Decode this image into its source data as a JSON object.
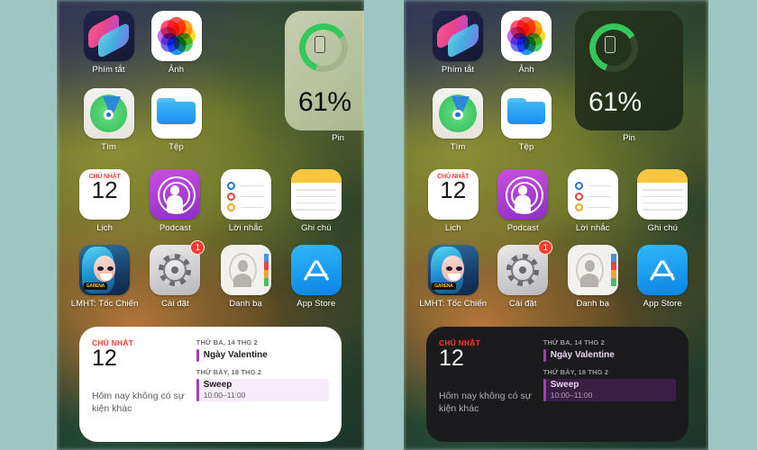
{
  "page": {
    "background_color": "#9dc6c2",
    "description": "Two iPhone home screen screenshots side by side showing light and dark appearance"
  },
  "phones": [
    {
      "id": "light",
      "mode": "light",
      "battery_widget": {
        "percent_label": "61%",
        "percent_value": 61,
        "label": "Pin",
        "ring_color": "#34c759",
        "glyph": "phone-icon"
      },
      "calendar_widget": {
        "weekday": "CHỦ NHẬT",
        "day": "12",
        "no_events": "Hôm nay không có sự kiện khác",
        "sections": [
          {
            "header": "THỨ BA, 14 THG 2",
            "events": [
              {
                "title": "Ngày Valentine",
                "time": "",
                "filled": false,
                "accent": "#a23fb8"
              }
            ]
          },
          {
            "header": "THỨ BẢY, 18 THG 2",
            "events": [
              {
                "title": "Sweep",
                "time": "10:00–11:00",
                "filled": true,
                "accent": "#a23fb8"
              }
            ]
          }
        ]
      },
      "app_rows": [
        [
          {
            "label": "Phím tắt",
            "icon": "shortcuts-icon",
            "badge": null
          },
          {
            "label": "Ảnh",
            "icon": "photos-icon",
            "badge": null
          }
        ],
        [
          {
            "label": "Tìm",
            "icon": "findmy-icon",
            "badge": null
          },
          {
            "label": "Tệp",
            "icon": "files-icon",
            "badge": null
          }
        ],
        [
          {
            "label": "Lịch",
            "icon": "calendar-icon",
            "badge": null,
            "cal_top": "CHỦ NHẬT",
            "cal_day": "12"
          },
          {
            "label": "Podcast",
            "icon": "podcasts-icon",
            "badge": null
          },
          {
            "label": "Lời nhắc",
            "icon": "reminders-icon",
            "badge": null
          },
          {
            "label": "Ghi chú",
            "icon": "notes-icon",
            "badge": null
          }
        ],
        [
          {
            "label": "LMHT: Tốc Chiến",
            "icon": "game-icon",
            "badge": null,
            "tag": "GARENA"
          },
          {
            "label": "Cài đặt",
            "icon": "settings-icon",
            "badge": "1"
          },
          {
            "label": "Danh bạ",
            "icon": "contacts-icon",
            "badge": null
          },
          {
            "label": "App Store",
            "icon": "appstore-icon",
            "badge": null
          }
        ]
      ]
    },
    {
      "id": "dark",
      "mode": "dark",
      "battery_widget": {
        "percent_label": "61%",
        "percent_value": 61,
        "label": "Pin",
        "ring_color": "#34c759",
        "glyph": "phone-icon"
      },
      "calendar_widget": {
        "weekday": "CHỦ NHẬT",
        "day": "12",
        "no_events": "Hôm nay không có sự kiện khác",
        "sections": [
          {
            "header": "THỨ BA, 14 THG 2",
            "events": [
              {
                "title": "Ngày Valentine",
                "time": "",
                "filled": false,
                "accent": "#a23fb8"
              }
            ]
          },
          {
            "header": "THỨ BẢY, 18 THG 2",
            "events": [
              {
                "title": "Sweep",
                "time": "10:00–11:00",
                "filled": true,
                "accent": "#a23fb8"
              }
            ]
          }
        ]
      },
      "app_rows": [
        [
          {
            "label": "Phím tắt",
            "icon": "shortcuts-icon",
            "badge": null
          },
          {
            "label": "Ảnh",
            "icon": "photos-icon",
            "badge": null
          }
        ],
        [
          {
            "label": "Tìm",
            "icon": "findmy-icon",
            "badge": null
          },
          {
            "label": "Tệp",
            "icon": "files-icon",
            "badge": null
          }
        ],
        [
          {
            "label": "Lịch",
            "icon": "calendar-icon",
            "badge": null,
            "cal_top": "CHỦ NHẬT",
            "cal_day": "12"
          },
          {
            "label": "Podcast",
            "icon": "podcasts-icon",
            "badge": null
          },
          {
            "label": "Lời nhắc",
            "icon": "reminders-icon",
            "badge": null
          },
          {
            "label": "Ghi chú",
            "icon": "notes-icon",
            "badge": null
          }
        ],
        [
          {
            "label": "LMHT: Tốc Chiến",
            "icon": "game-icon",
            "badge": null,
            "tag": "GARENA"
          },
          {
            "label": "Cài đặt",
            "icon": "settings-icon",
            "badge": "1"
          },
          {
            "label": "Danh bạ",
            "icon": "contacts-icon",
            "badge": null
          },
          {
            "label": "App Store",
            "icon": "appstore-icon",
            "badge": null
          }
        ]
      ]
    }
  ]
}
